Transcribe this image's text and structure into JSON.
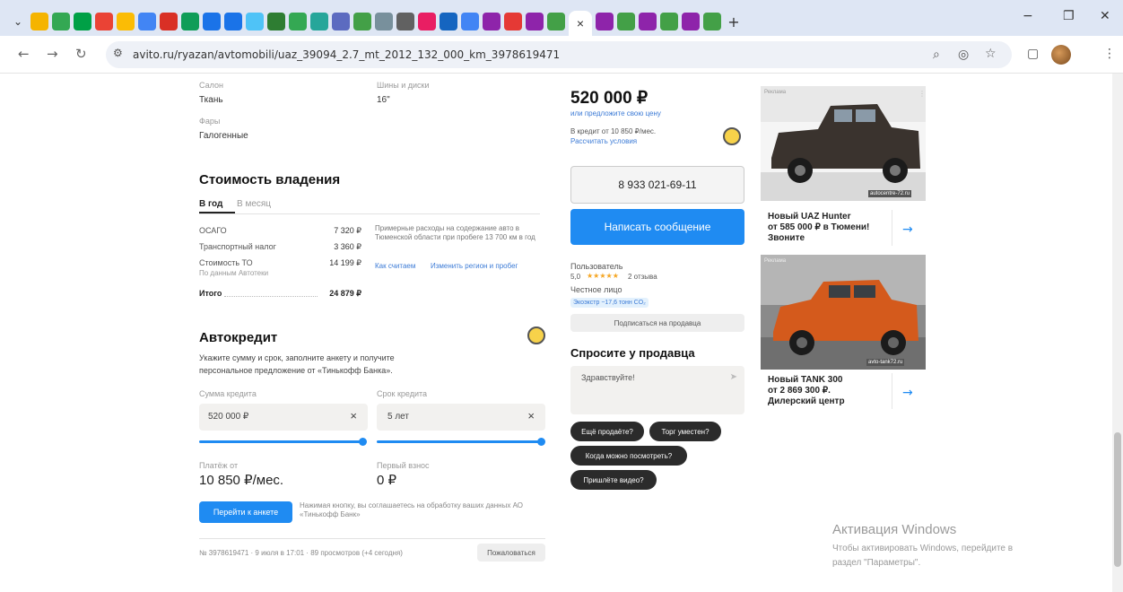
{
  "browser": {
    "close_tab": "×",
    "new_tab": "+",
    "minimize": "−",
    "restore": "❐",
    "close": "✕",
    "url": "avito.ru/ryazan/avtomobili/uaz_39094_2.7_mt_2012_132_000_km_3978619471"
  },
  "specs": {
    "salon_label": "Салон",
    "salon_value": "Ткань",
    "wheels_label": "Шины и диски",
    "wheels_value": "16\"",
    "lights_label": "Фары",
    "lights_value": "Галогенные"
  },
  "ownership": {
    "title": "Стоимость владения",
    "tab_year": "В год",
    "tab_month": "В месяц",
    "osago_label": "ОСАГО",
    "osago_value": "7 320 ₽",
    "tax_label": "Транспортный налог",
    "tax_value": "3 360 ₽",
    "to_label": "Стоимость ТО",
    "to_sub": "По данным Автотеки",
    "to_value": "14 199 ₽",
    "total_label": "Итого",
    "total_value": "24 879 ₽",
    "note": "Примерные расходы на содержание авто в Тюменской области при пробеге 13 700 км в год",
    "how_link": "Как считаем",
    "change_link": "Изменить регион и пробег"
  },
  "credit": {
    "title": "Автокредит",
    "desc1": "Укажите сумму и срок, заполните анкету и получите",
    "desc2": "персональное предложение от «Тинькофф Банка».",
    "sum_label": "Сумма кредита",
    "sum_value": "520 000 ₽",
    "term_label": "Срок кредита",
    "term_value": "5 лет",
    "clear": "×",
    "payment_label": "Платёж от",
    "payment_value": "10 850 ₽/мес.",
    "down_label": "Первый взнос",
    "down_value": "0 ₽",
    "apply_button": "Перейти к анкете",
    "consent": "Нажимая кнопку, вы соглашаетесь на обработку ваших данных АО «Тинькофф Банк»",
    "slider_sum_fraction": 1.0,
    "slider_term_fraction": 1.0
  },
  "footer": {
    "meta": "№ 3978619471 · 9 июля в 17:01 · 89 просмотров (+4 сегодня)",
    "report_button": "Пожаловаться"
  },
  "offer": {
    "price": "520 000 ₽",
    "suggest_link": "или предложите свою цену",
    "credit_line": "В кредит от 10 850 ₽/мес.",
    "credit_link": "Рассчитать условия",
    "phone": "8 933 021-69-11",
    "message_button": "Написать сообщение",
    "seller_type": "Пользователь",
    "rating": "5,0",
    "stars": "★★★★★",
    "reviews": "2 отзыва",
    "honest": "Честное лицо",
    "eco_badge": "Экоэкстр −17,6 тонн CO₂",
    "subscribe_button": "Подписаться на продавца",
    "ask_title": "Спросите у продавца",
    "ask_placeholder": "Здравствуйте!",
    "send_icon": "➤",
    "q1": "Ещё продаёте?",
    "q2": "Торг уместен?",
    "q3": "Когда можно посмотреть?",
    "q4": "Пришлёте видео?"
  },
  "ads": [
    {
      "label": "Реклама",
      "text1": "Новый UAZ Hunter",
      "text2": "от 585 000 ₽ в Тюмени!",
      "text3": "Звоните",
      "badge": "autocentre-72.ru",
      "arrow": "→"
    },
    {
      "label": "Реклама",
      "text1": "Новый TANK 300",
      "text2": "от 2 869 300 ₽.",
      "text3": "Дилерский центр",
      "badge": "avto-tank72.ru",
      "arrow": "→"
    }
  ],
  "windows": {
    "title": "Активация Windows",
    "line1": "Чтобы активировать Windows, перейдите в",
    "line2": "раздел \"Параметры\"."
  }
}
